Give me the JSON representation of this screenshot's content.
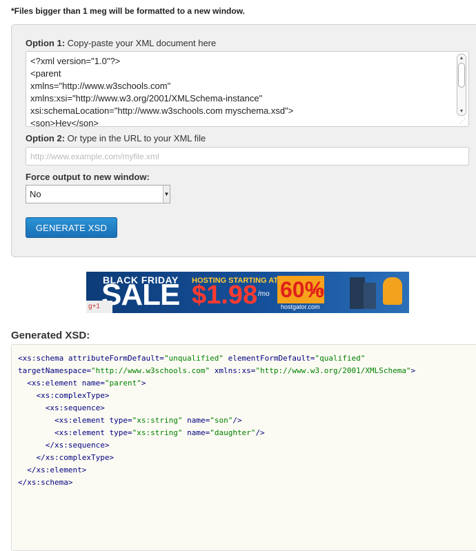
{
  "notice": "*Files bigger than 1 meg will be formatted to a new window.",
  "option1": {
    "label_bold": "Option 1:",
    "label_rest": " Copy-paste your XML document here",
    "xml_lines": [
      "<?xml version=\"1.0\"?>",
      "<parent",
      "xmlns=\"http://www.w3schools.com\"",
      "xmlns:xsi=\"http://www.w3.org/2001/XMLSchema-instance\"",
      "xsi:schemaLocation=\"http://www.w3schools.com myschema.xsd\">",
      "<son>Hey</son>"
    ]
  },
  "option2": {
    "label_bold": "Option 2:",
    "label_rest": " Or type in the URL to your XML file",
    "placeholder": "http://www.example.com/myfile.xml"
  },
  "force_output": {
    "label": "Force output to new window:",
    "selected": "No"
  },
  "generate_button": "GENERATE XSD",
  "ad": {
    "line1": "BLACK FRIDAY",
    "line2": "SALE",
    "hosting": "HOSTING STARTING AT",
    "price": "$1.98",
    "per": "/mo",
    "percent": "60%",
    "off": "OFF",
    "brand": "hostgator.com",
    "gplus": "g+1"
  },
  "generated_title": "Generated XSD:",
  "xsd": {
    "l1_tag": "<xs:schema",
    "l1_a1n": " attributeFormDefault=",
    "l1_a1v": "\"unqualified\"",
    "l1_a2n": " elementFormDefault=",
    "l1_a2v": "\"qualified\"",
    "l2_a1n": "targetNamespace=",
    "l2_a1v": "\"http://www.w3schools.com\"",
    "l2_a2n": " xmlns:xs=",
    "l2_a2v": "\"http://www.w3.org/2001/XMLSchema\"",
    "l2_end": ">",
    "l3_tag": "  <xs:element",
    "l3_an": " name=",
    "l3_av": "\"parent\"",
    "l3_end": ">",
    "l4": "    <xs:complexType>",
    "l5": "      <xs:sequence>",
    "l6_tag": "        <xs:element",
    "l6_a1n": " type=",
    "l6_a1v": "\"xs:string\"",
    "l6_a2n": " name=",
    "l6_a2v": "\"son\"",
    "l6_end": "/>",
    "l7_tag": "        <xs:element",
    "l7_a1n": " type=",
    "l7_a1v": "\"xs:string\"",
    "l7_a2n": " name=",
    "l7_a2v": "\"daughter\"",
    "l7_end": "/>",
    "l8": "      </xs:sequence>",
    "l9": "    </xs:complexType>",
    "l10": "  </xs:element>",
    "l11": "</xs:schema>"
  }
}
